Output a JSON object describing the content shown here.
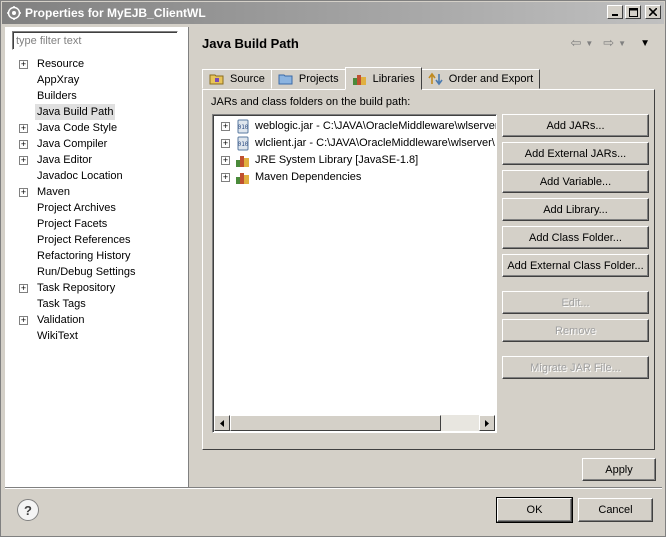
{
  "window": {
    "title": "Properties for MyEJB_ClientWL"
  },
  "filter": {
    "placeholder": "type filter text"
  },
  "nav": {
    "items": [
      {
        "label": "Resource",
        "expandable": true
      },
      {
        "label": "AppXray",
        "expandable": false
      },
      {
        "label": "Builders",
        "expandable": false
      },
      {
        "label": "Java Build Path",
        "expandable": false,
        "selected": true
      },
      {
        "label": "Java Code Style",
        "expandable": true
      },
      {
        "label": "Java Compiler",
        "expandable": true
      },
      {
        "label": "Java Editor",
        "expandable": true
      },
      {
        "label": "Javadoc Location",
        "expandable": false
      },
      {
        "label": "Maven",
        "expandable": true
      },
      {
        "label": "Project Archives",
        "expandable": false
      },
      {
        "label": "Project Facets",
        "expandable": false
      },
      {
        "label": "Project References",
        "expandable": false
      },
      {
        "label": "Refactoring History",
        "expandable": false
      },
      {
        "label": "Run/Debug Settings",
        "expandable": false
      },
      {
        "label": "Task Repository",
        "expandable": true
      },
      {
        "label": "Task Tags",
        "expandable": false
      },
      {
        "label": "Validation",
        "expandable": true
      },
      {
        "label": "WikiText",
        "expandable": false
      }
    ]
  },
  "page": {
    "title": "Java Build Path"
  },
  "tabs": [
    {
      "label": "Source",
      "icon": "source-folder-icon"
    },
    {
      "label": "Projects",
      "icon": "projects-folder-icon"
    },
    {
      "label": "Libraries",
      "icon": "libraries-icon",
      "active": true
    },
    {
      "label": "Order and Export",
      "icon": "order-export-icon"
    }
  ],
  "libraries": {
    "caption": "JARs and class folders on the build path:",
    "entries": [
      {
        "label": "weblogic.jar - C:\\JAVA\\OracleMiddleware\\wlserver",
        "icon": "jar-icon"
      },
      {
        "label": "wlclient.jar - C:\\JAVA\\OracleMiddleware\\wlserver\\",
        "icon": "jar-icon"
      },
      {
        "label": "JRE System Library [JavaSE-1.8]",
        "icon": "library-icon"
      },
      {
        "label": "Maven Dependencies",
        "icon": "library-icon"
      }
    ],
    "buttons": {
      "add_jars": "Add JARs...",
      "add_external_jars": "Add External JARs...",
      "add_variable": "Add Variable...",
      "add_library": "Add Library...",
      "add_class_folder": "Add Class Folder...",
      "add_external_class_folder": "Add External Class Folder...",
      "edit": "Edit...",
      "remove": "Remove",
      "migrate_jar": "Migrate JAR File..."
    }
  },
  "footer": {
    "apply": "Apply",
    "ok": "OK",
    "cancel": "Cancel",
    "help_glyph": "?"
  }
}
